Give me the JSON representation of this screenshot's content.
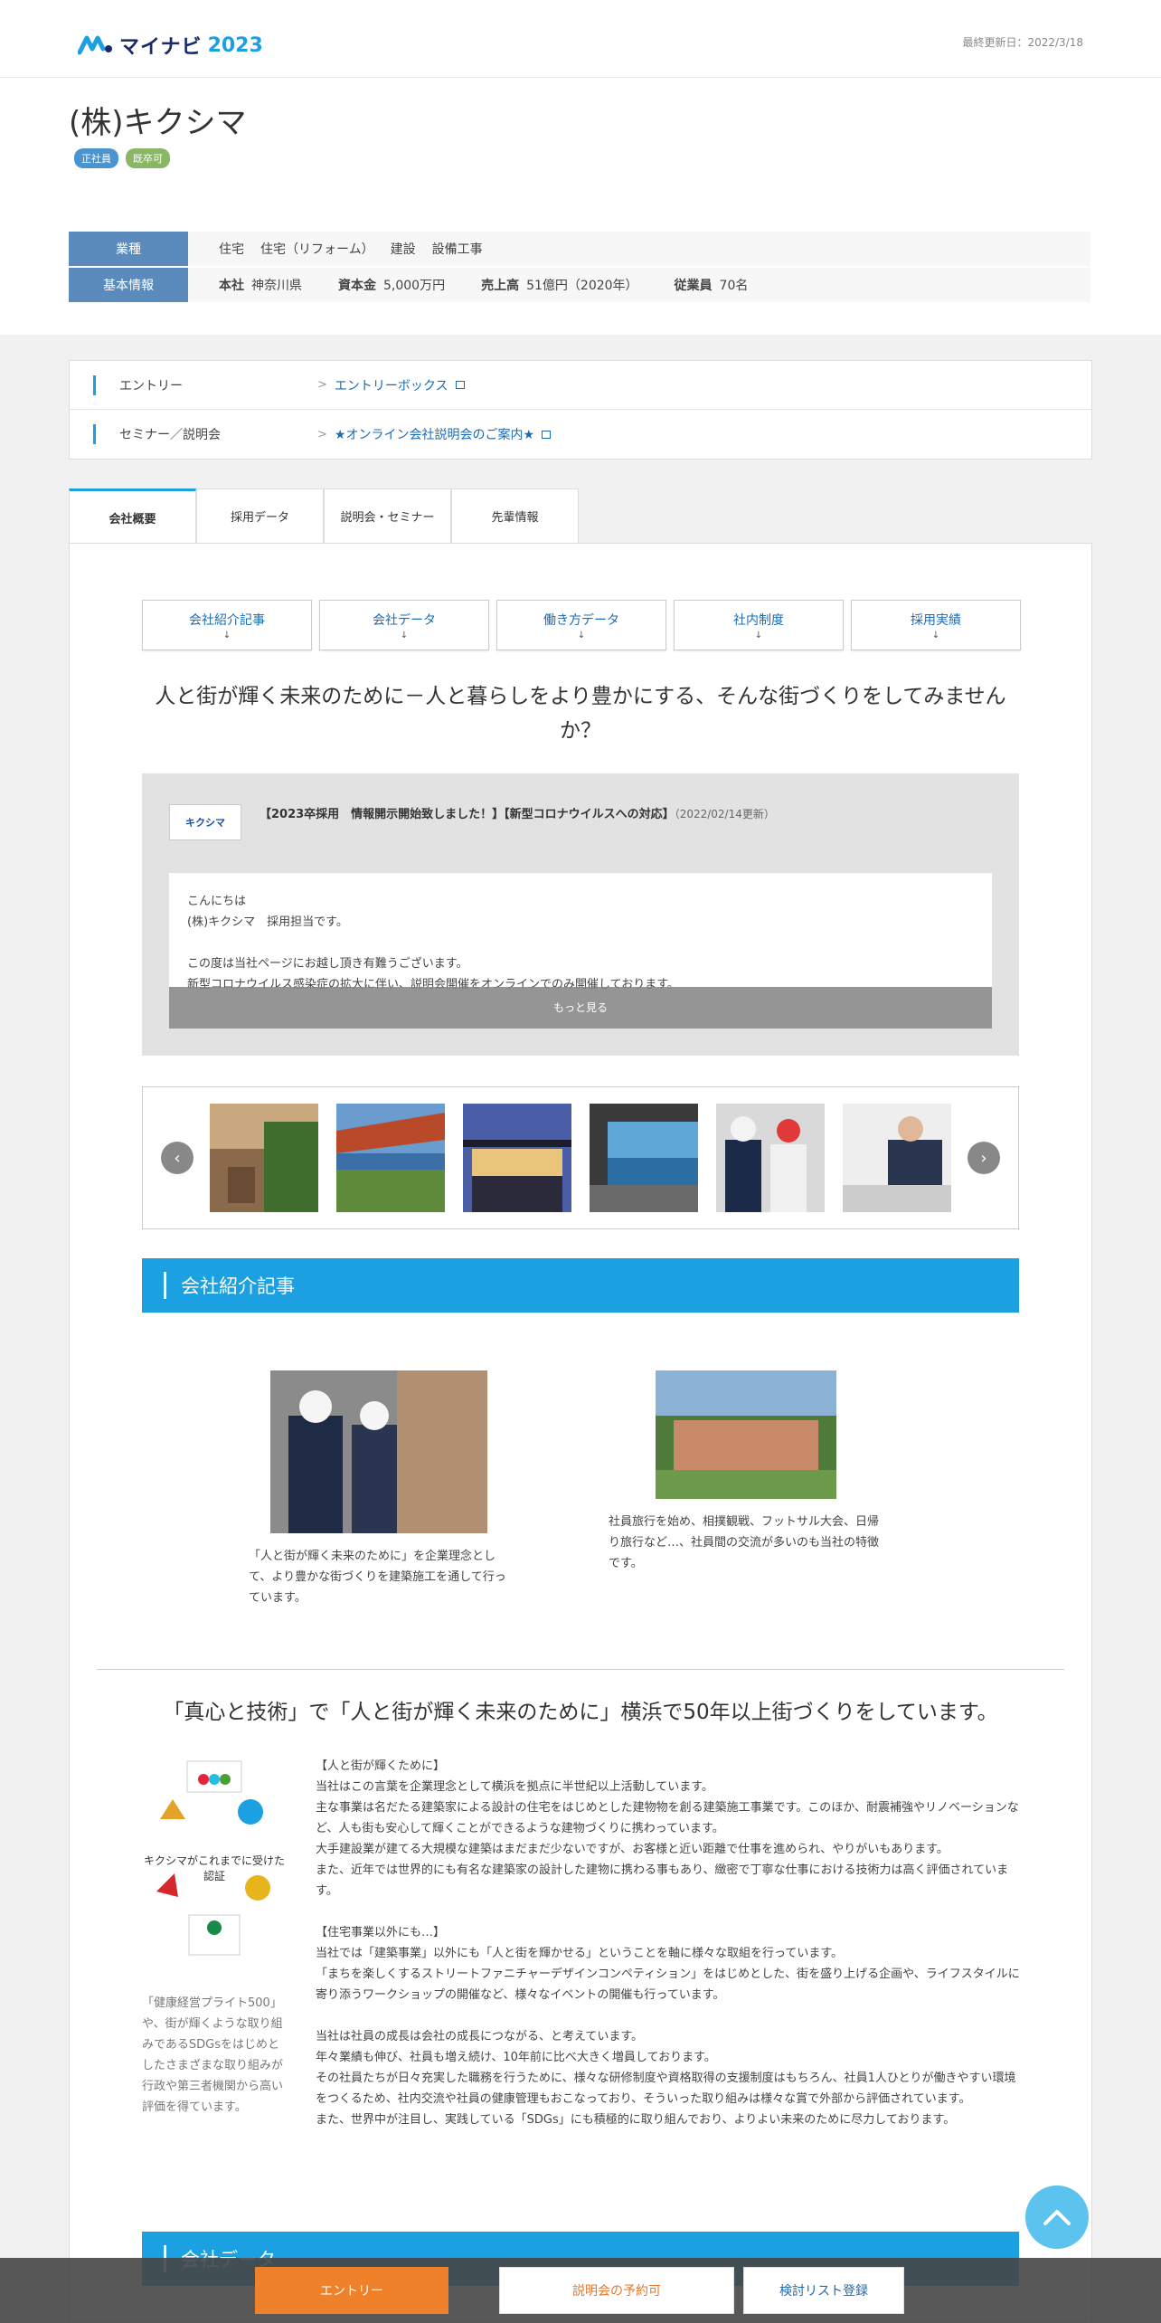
{
  "header": {
    "logo_text": "マイナビ",
    "logo_year": "2023",
    "updated": "最終更新日：2022/3/18"
  },
  "company": {
    "name": "(株)キクシマ",
    "badges": [
      "正社員",
      "既卒可"
    ]
  },
  "info": {
    "industry_label": "業種",
    "industries": [
      "住宅",
      "住宅（リフォーム）",
      "建設",
      "設備工事"
    ],
    "basic_label": "基本情報",
    "hq_label": "本社",
    "hq": "神奈川県",
    "capital_label": "資本金",
    "capital": "5,000万円",
    "sales_label": "売上高",
    "sales": "51億円（2020年）",
    "employees_label": "従業員",
    "employees": "70名"
  },
  "entry": {
    "entry_label": "エントリー",
    "entry_link": "エントリーボックス",
    "seminar_label": "セミナー／説明会",
    "seminar_link": "★オンライン会社説明会のご案内★"
  },
  "tabs": [
    "会社概要",
    "採用データ",
    "説明会・セミナー",
    "先輩情報"
  ],
  "quicknav": [
    "会社紹介記事",
    "会社データ",
    "働き方データ",
    "社内制度",
    "採用実績"
  ],
  "catch": "人と街が輝く未来のために－人と暮らしをより豊かにする、そんな街づくりをしてみませんか？",
  "news": {
    "logo": "キクシマ",
    "title": "【2023卒採用　情報開示開始致しました！】【新型コロナウイルスへの対応】",
    "date": "（2022/02/14更新）",
    "body": [
      "こんにちは",
      "(株)キクシマ　採用担当です。",
      "",
      "この度は当社ページにお越し頂き有難うございます。",
      "新型コロナウイルス感染症の拡大に伴い、説明会開催をオンラインでのみ開催しております。"
    ],
    "more": "もっと見る"
  },
  "sections": {
    "intro": "会社紹介記事",
    "data": "会社データ"
  },
  "articles": [
    {
      "caption": "「人と街が輝く未来のために」を企業理念として、より豊かな街づくりを建築施工を通して行っています。"
    },
    {
      "caption": "社員旅行を始め、相撲観戦、フットサル大会、日帰り旅行など…、社員間の交流が多いのも当社の特徴です。"
    }
  ],
  "catch2": "「真心と技術」で「人と街が輝く未来のために」横浜で50年以上街づくりをしています。",
  "certs": {
    "caption": "キクシマがこれまでに受けた認証",
    "text": "「健康経営プライト500」や、街が輝くような取り組みであるSDGsをはじめとしたさまざまな取り組みが行政や第三者機関から高い評価を得ています。"
  },
  "body_text": "【人と街が輝くために】\n当社はこの言葉を企業理念として横浜を拠点に半世紀以上活動しています。\n主な事業は名だたる建築家による設計の住宅をはじめとした建物物を創る建築施工事業です。このほか、耐震補強やリノベーションなど、人も街も安心して輝くことができるような建物づくりに携わっています。\n大手建設業が建てる大規模な建築はまだまだ少ないですが、お客様と近い距離で仕事を進められ、やりがいもあります。\nまた、近年では世界的にも有名な建築家の設計した建物に携わる事もあり、緻密で丁寧な仕事における技術力は高く評価されています。\n\n【住宅事業以外にも…】\n当社では「建築事業」以外にも「人と街を輝かせる」ということを軸に様々な取組を行っています。\n「まちを楽しくするストリートファニチャーデザインコンペティション」をはじめとした、街を盛り上げる企画や、ライフスタイルに寄り添うワークショップの開催など、様々なイベントの開催も行っています。\n\n当社は社員の成長は会社の成長につながる、と考えています。\n年々業績も伸び、社員も増え続け、10年前に比べ大きく増員しております。\nその社員たちが日々充実した職務を行うために、様々な研修制度や資格取得の支援制度はもちろん、社員1人ひとりが働きやすい環境をつくるため、社内交流や社員の健康管理もおこなっており、そういった取り組みは様々な賞で外部から評価されています。\nまた、世界中が注目し、実践している「SDGs」にも積極的に取り組んでおり、よりよい未来のために尽力しております。",
  "bottom": {
    "entry": "エントリー",
    "seminar": "説明会の予約可",
    "list": "検討リスト登録"
  },
  "colors": {
    "accent": "#1ba1e2",
    "entry": "#f0812b",
    "info_head": "#5b8bbd"
  }
}
